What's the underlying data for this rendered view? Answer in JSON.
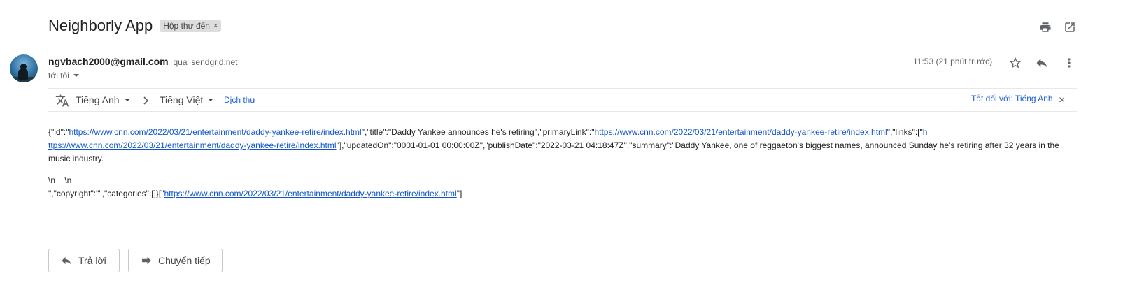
{
  "subject": {
    "title": "Neighborly App",
    "label": "Hộp thư đến",
    "label_close": "×"
  },
  "toolbar_icons": [
    "print-icon",
    "open-in-new-window-icon"
  ],
  "sender": {
    "email": "ngvbach2000@gmail.com",
    "via": "qua",
    "via_domain": "sendgrid.net",
    "to": "tới tôi",
    "time": "11:53 (21 phút trước)",
    "icons": [
      "star-icon",
      "reply-icon",
      "more-vert-icon"
    ]
  },
  "translate": {
    "from_lang": "Tiếng Anh",
    "to_lang": "Tiếng Việt",
    "translate_link": "Dịch thư",
    "turn_off": "Tắt đối với: Tiếng Anh",
    "close": "×",
    "icon": "translate-icon"
  },
  "body": {
    "t1": "{\"id\":\"",
    "url": "https://www.cnn.com/2022/03/21/entertainment/daddy-yankee-retire/index.html",
    "t2": "\",\"title\":\"Daddy Yankee announces he's retiring\",\"primaryLink\":\"",
    "t3": "\",\"links\":[\"",
    "url_break_a": "h",
    "url_break_b": "ttps://www.cnn.com/2022/03/21/entertainment/daddy-yankee-retire/index.html",
    "t4": "\"],\"updatedOn\":\"0001-01-01 00:00:00Z\",\"publishDate\":\"2022-03-21 04:18:47Z\",\"summary\":\"Daddy Yankee, one of reggaeton's biggest names, announced Sunday he's retiring after 32 years in the music industry.",
    "raw_line1": "\\n    \\n",
    "t5": "\",\"copyright\":\"\",\"categories\":[]}[\"",
    "t6": "\"]"
  },
  "actions": {
    "reply": "Trả lời",
    "forward": "Chuyển tiếp"
  }
}
